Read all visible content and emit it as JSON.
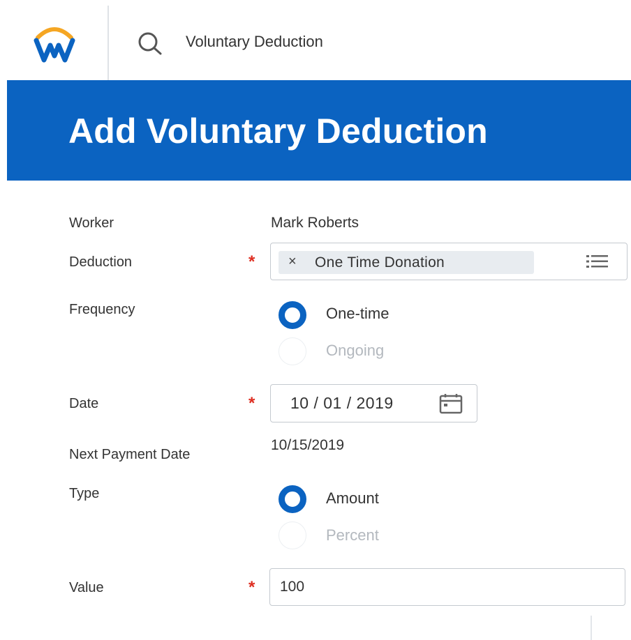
{
  "search": {
    "text": "Voluntary Deduction"
  },
  "header": {
    "title": "Add Voluntary Deduction"
  },
  "colors": {
    "brand_blue": "#0b63c1",
    "required_red": "#de2e21",
    "logo_orange": "#f5a623"
  },
  "form": {
    "worker": {
      "label": "Worker",
      "value": "Mark Roberts"
    },
    "deduction": {
      "label": "Deduction",
      "required": "*",
      "selected": "One Time Donation",
      "remove_icon": "×"
    },
    "frequency": {
      "label": "Frequency",
      "options": [
        {
          "label": "One-time",
          "selected": true
        },
        {
          "label": "Ongoing",
          "selected": false
        }
      ]
    },
    "date": {
      "label": "Date",
      "required": "*",
      "value": "10 / 01 / 2019"
    },
    "next_payment_date": {
      "label": "Next Payment Date",
      "value": "10/15/2019"
    },
    "type": {
      "label": "Type",
      "options": [
        {
          "label": "Amount",
          "selected": true
        },
        {
          "label": "Percent",
          "selected": false
        }
      ]
    },
    "value": {
      "label": "Value",
      "required": "*",
      "value": "100"
    }
  },
  "icons": [
    "workday-logo",
    "search-icon",
    "remove-icon",
    "list-icon",
    "calendar-icon"
  ]
}
